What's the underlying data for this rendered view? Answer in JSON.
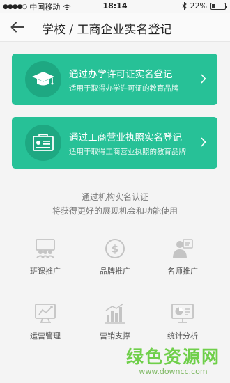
{
  "status_bar": {
    "carrier": "中国移动",
    "time": "18:14",
    "battery_percent": "22%",
    "battery_level": 0.22
  },
  "nav": {
    "title": "学校 / 工商企业实名登记"
  },
  "cards": [
    {
      "title": "通过办学许可证实名登记",
      "subtitle": "适用于取得办学许可证的教育品牌",
      "icon": "graduation-cap-icon"
    },
    {
      "title": "通过工商营业执照实名登记",
      "subtitle": "适用于取得工商营业执照的教育品牌",
      "icon": "business-license-icon"
    }
  ],
  "info": {
    "line1": "通过机构实名认证",
    "line2": "将获得更好的展现机会和功能使用"
  },
  "features": [
    {
      "label": "班课推广",
      "icon": "class-promotion-icon"
    },
    {
      "label": "品牌推广",
      "icon": "brand-dollar-icon"
    },
    {
      "label": "名师推广",
      "icon": "teacher-icon"
    },
    {
      "label": "运营管理",
      "icon": "monitor-chart-icon"
    },
    {
      "label": "营销支撑",
      "icon": "bar-chart-icon"
    },
    {
      "label": "统计分析",
      "icon": "pie-chart-board-icon"
    }
  ],
  "watermark": {
    "text": "绿色资源网",
    "url": "www.downcc.com"
  },
  "colors": {
    "card_green": "#27c197",
    "icon_gray": "#c4c4c4"
  }
}
